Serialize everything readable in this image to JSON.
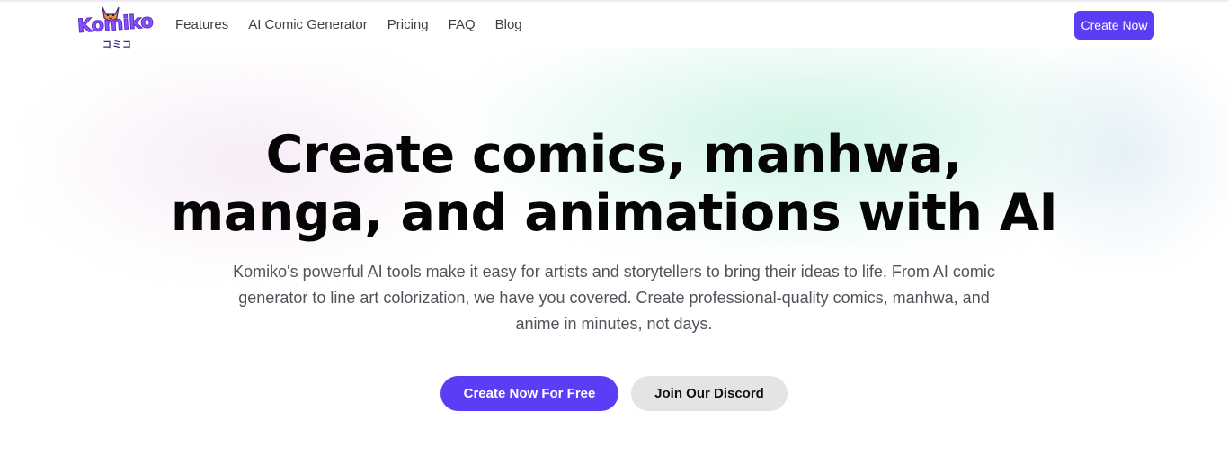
{
  "brand": {
    "name": "Komiko",
    "kana": "コミコ",
    "accent": "#5b3df5"
  },
  "nav": {
    "links": [
      "Features",
      "AI Comic Generator",
      "Pricing",
      "FAQ",
      "Blog"
    ],
    "cta_label": "Create Now"
  },
  "hero": {
    "title_line1": "Create comics, manhwa,",
    "title_line2": "manga, and animations with AI",
    "subtitle": "Komiko's powerful AI tools make it easy for artists and storytellers to bring their ideas to life. From AI comic generator to line art colorization, we have you covered. Create professional-quality comics, manhwa, and anime in minutes, not days.",
    "primary_cta": "Create Now For Free",
    "secondary_cta": "Join Our Discord"
  }
}
